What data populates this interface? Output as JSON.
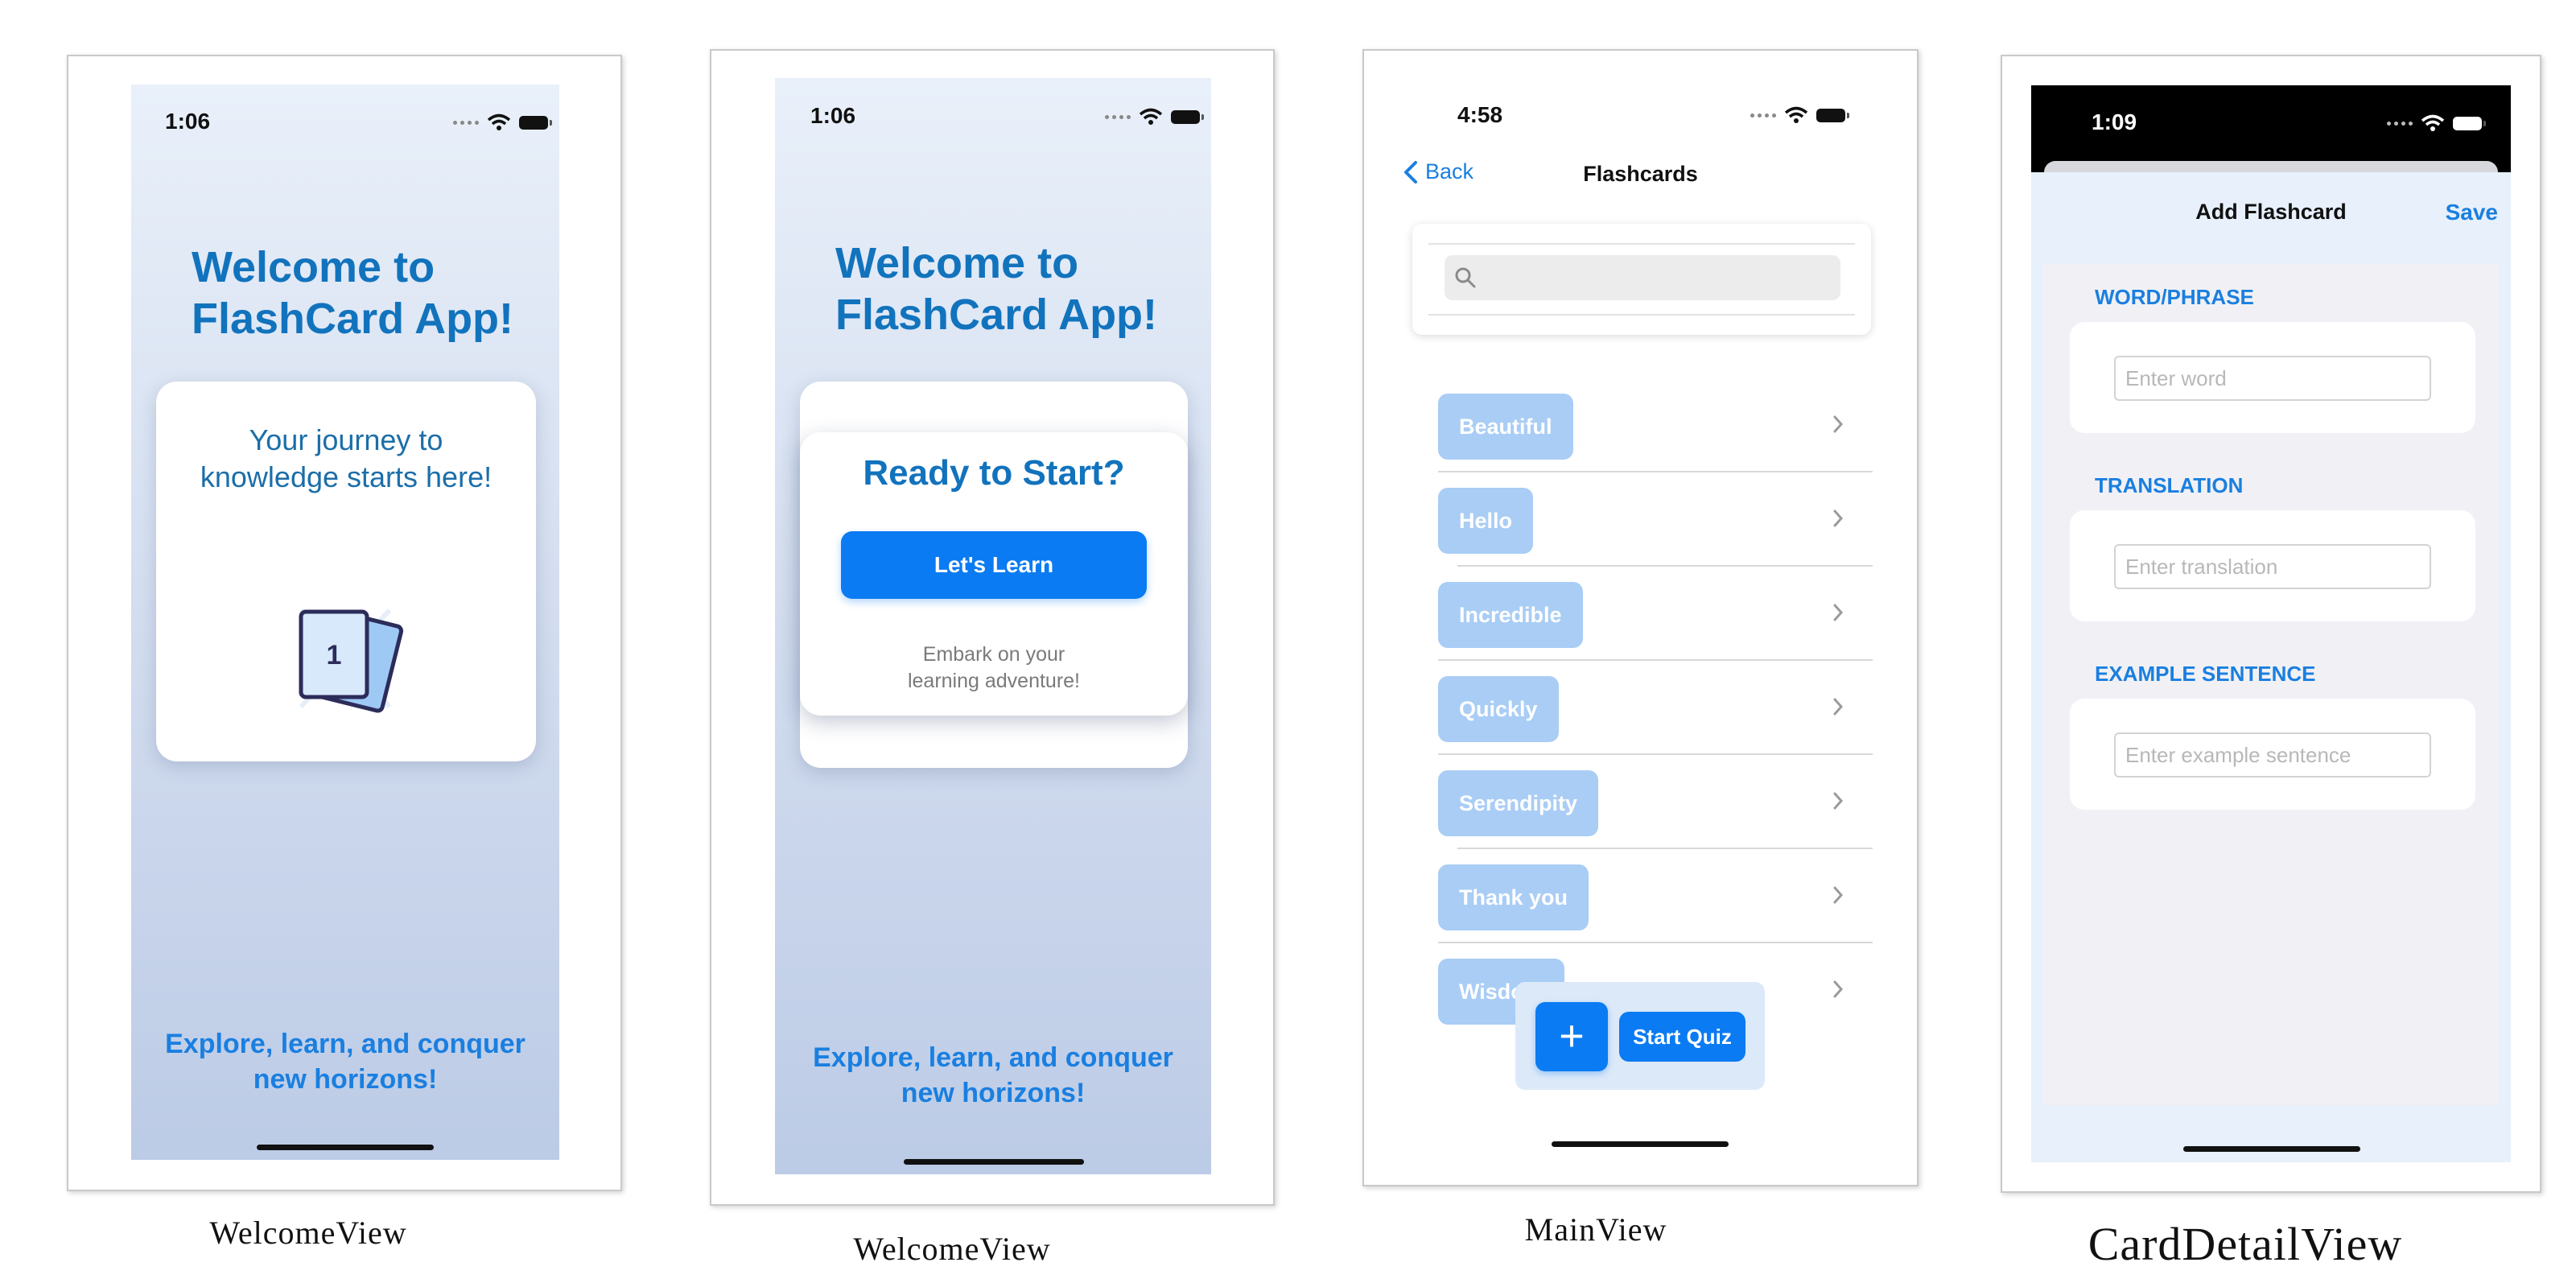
{
  "screens": {
    "welcome1": {
      "caption": "WelcomeView",
      "time": "1:06",
      "title_line1": "Welcome to",
      "title_line2": "FlashCard App!",
      "card_line1": "Your journey to",
      "card_line2": "knowledge starts here!",
      "card_icon_number": "1",
      "tagline_line1": "Explore, learn, and conquer",
      "tagline_line2": "new horizons!"
    },
    "welcome2": {
      "caption": "WelcomeView",
      "time": "1:06",
      "title_line1": "Welcome to",
      "title_line2": "FlashCard App!",
      "ready_heading": "Ready to Start?",
      "button_label": "Let's Learn",
      "sub_line1": "Embark on your",
      "sub_line2": "learning adventure!",
      "tagline_line1": "Explore, learn, and conquer",
      "tagline_line2": "new horizons!"
    },
    "main": {
      "caption": "MainView",
      "time": "4:58",
      "back_label": "Back",
      "nav_title": "Flashcards",
      "search_placeholder": "",
      "items": [
        "Beautiful",
        "Hello",
        "Incredible",
        "Quickly",
        "Serendipity",
        "Thank you",
        "Wisdom"
      ],
      "add_label": "+",
      "quiz_label": "Start Quiz"
    },
    "detail": {
      "caption": "CardDetailView",
      "time": "1:09",
      "title": "Add Flashcard",
      "save_label": "Save",
      "section1_label": "WORD/PHRASE",
      "section1_placeholder": "Enter word",
      "section2_label": "TRANSLATION",
      "section2_placeholder": "Enter translation",
      "section3_label": "EXAMPLE SENTENCE",
      "section3_placeholder": "Enter example sentence"
    }
  },
  "colors": {
    "accent": "#1a7fe0",
    "button_blue": "#0a7bf2",
    "title_blue": "#1273bd",
    "pill_blue": "#a9cdf5"
  }
}
